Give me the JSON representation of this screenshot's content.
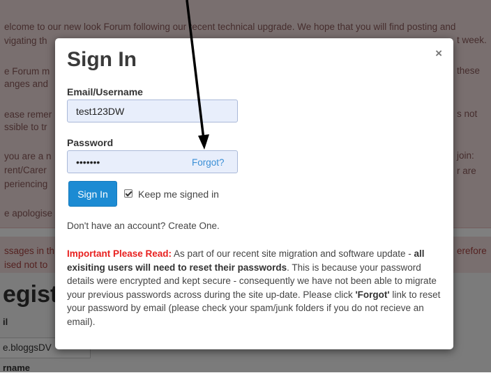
{
  "background": {
    "notice_lines": [
      "elcome to our new look Forum following our recent technical upgrade. We hope that you will find posting and",
      "vigating th",
      "e Forum m",
      "anges and",
      "ease remer",
      "ssible to tr",
      "you are a n",
      "rent/Carer",
      "periencing",
      "e apologise"
    ],
    "notice_right": [
      "t week.",
      "these",
      "s not",
      "join:",
      "r are"
    ],
    "error_left": [
      "ssages in th",
      "ised not to"
    ],
    "error_right": "erefore",
    "heading": "egist",
    "label1": "il",
    "input_value": "e.bloggsDV",
    "label2": "rname"
  },
  "modal": {
    "title": "Sign In",
    "close": "×",
    "email_label": "Email/Username",
    "email_value": "test123DW",
    "password_label": "Password",
    "password_value": "•••••••",
    "forgot": "Forgot?",
    "signin_button": "Sign In",
    "keep_signed_in": "Keep me signed in",
    "create_account": "Don't have an account? Create One.",
    "important_label": "Important Please Read:",
    "important_text1": " As part of our recent site migration and software update - ",
    "important_bold": "all exisiting users will need to reset their passwords",
    "important_text2": ". This is because your password details were encrypted and kept secure - consequently we have not been able to migrate your previous passwords across during the site up-date. Please click ",
    "important_forgot": "'Forgot'",
    "important_text3": " link to reset your password by email (please check your spam/junk folders if you do not recieve an email)."
  },
  "colors": {
    "primary": "#1c8bd3",
    "link": "#3a8fd6",
    "important": "#e8201f",
    "input_bg": "#e8eefb"
  }
}
